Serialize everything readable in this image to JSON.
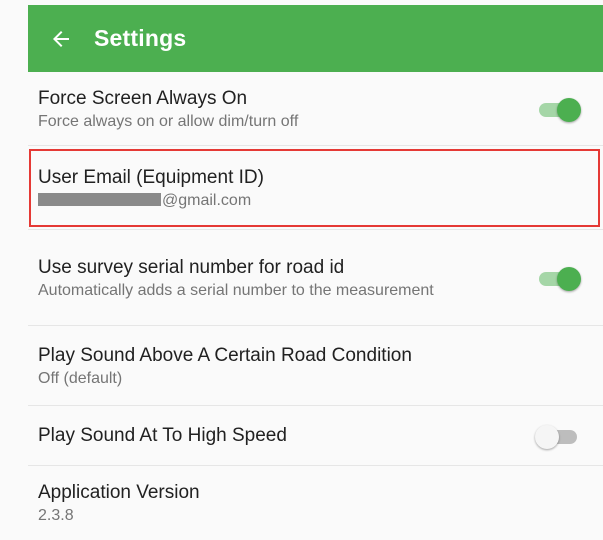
{
  "app_bar": {
    "title": "Settings",
    "back_icon": "arrow-left-icon",
    "color": "#4caf50"
  },
  "settings": [
    {
      "title": "Force Screen Always On",
      "subtitle": "Force always on or allow dim/turn off",
      "toggle": true
    },
    {
      "title": "User Email (Equipment ID)",
      "subtitle": "@gmail.com",
      "redacted": true
    },
    {
      "title": "Use survey serial number for road id",
      "subtitle": "Automatically adds a serial number to the measurement",
      "toggle": true
    },
    {
      "title": "Play Sound Above A Certain Road Condition",
      "subtitle": "Off (default)"
    },
    {
      "title": "Play Sound At To High Speed",
      "toggle": false
    },
    {
      "title": "Application Version",
      "subtitle": "2.3.8"
    }
  ],
  "accent_color": "#4caf50",
  "highlight_color": "#e53935"
}
